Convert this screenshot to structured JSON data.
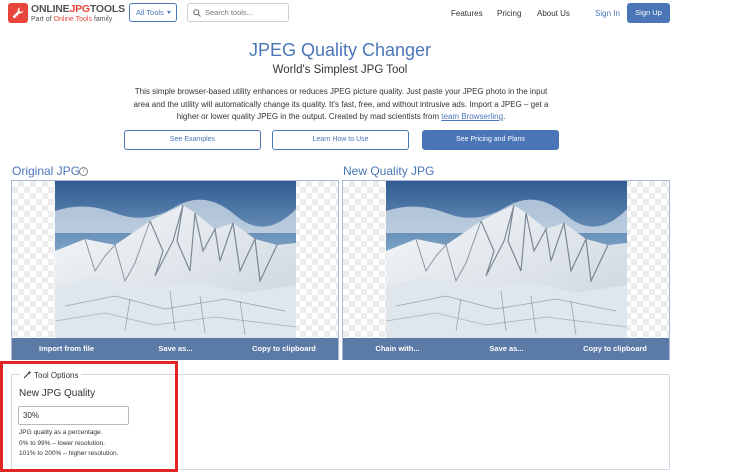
{
  "header": {
    "logo_part1": "ONLINE",
    "logo_part2": "JPG",
    "logo_part3": "TOOLS",
    "logo_sub_prefix": "Part of ",
    "logo_sub_link": "Online Tools",
    "logo_sub_suffix": " family",
    "all_tools_label": "All Tools",
    "search_placeholder": "Search tools...",
    "nav": {
      "features": "Features",
      "pricing": "Pricing",
      "about": "About Us"
    },
    "sign_in": "Sign In",
    "sign_up": "Sign Up"
  },
  "hero": {
    "title": "JPEG Quality Changer",
    "subtitle": "World's Simplest JPG Tool",
    "description": "This simple browser-based utility enhances or reduces JPEG picture quality. Just paste your JPEG photo in the input area and the utility will automatically change its quality. It's fast, free, and without intrusive ads. Import a JPEG – get a higher or lower quality JPEG in the output. Created by mad scientists from ",
    "description_link": "team Browserling",
    "description_end": ".",
    "buttons": {
      "examples": "See Examples",
      "learn": "Learn How to Use",
      "pricing": "See Pricing and Plans"
    }
  },
  "input_panel": {
    "title": "Original JPG",
    "help_icon_glyph": "?",
    "actions": [
      "Import from file",
      "Save as...",
      "Copy to clipboard"
    ]
  },
  "output_panel": {
    "title": "New Quality JPG",
    "actions": [
      "Chain with...",
      "Save as...",
      "Copy to clipboard"
    ]
  },
  "tool_options": {
    "heading": "Tool Options",
    "quality_label": "New JPG Quality",
    "quality_value": "30%",
    "help_line1": "JPG quality as a percentage.",
    "help_line2": "0% to 99% – lower resolution.",
    "help_line3": "101% to 200% – higher resolution."
  },
  "icons": {
    "logo": "wrench-icon",
    "dropdown": "caret-down-icon",
    "search": "search-icon",
    "help": "help-circle-icon",
    "options": "magic-wand-icon"
  },
  "colors": {
    "brand_red": "#e8453c",
    "accent_blue": "#4a76b8",
    "panel_bar": "#5b7aa6",
    "highlight": "#e32424"
  }
}
